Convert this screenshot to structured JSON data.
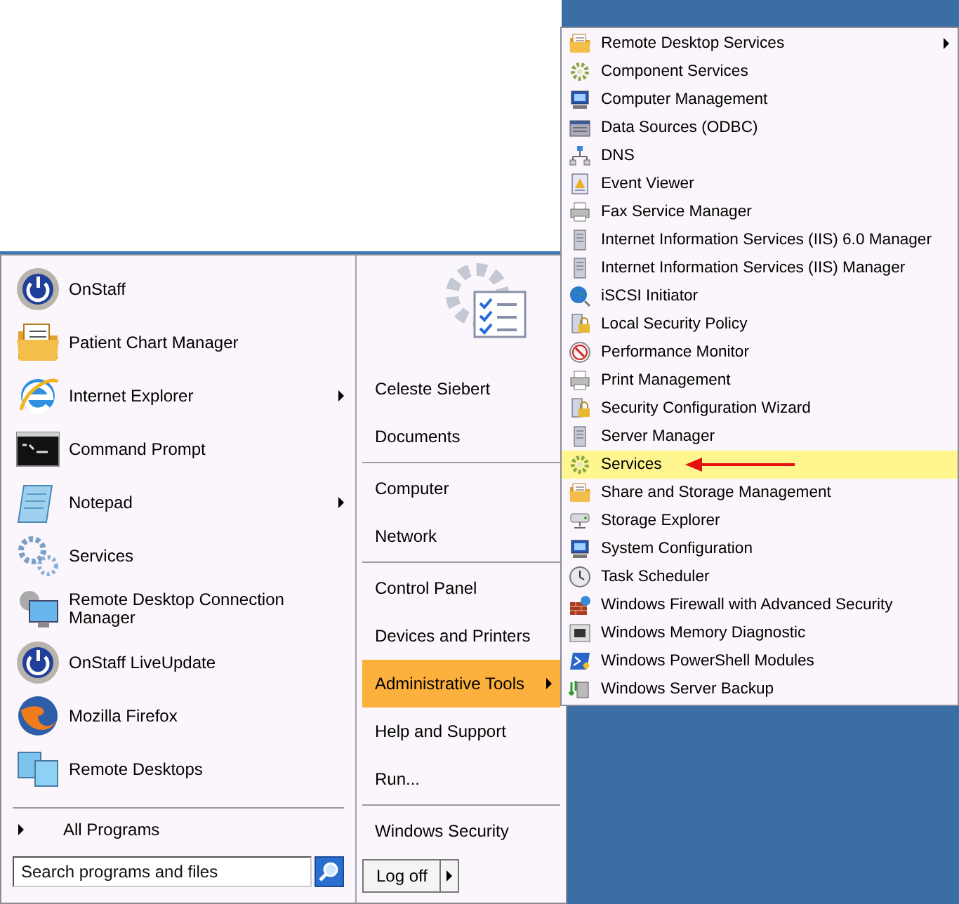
{
  "programs": [
    {
      "label": "OnStaff",
      "kind": "power",
      "has_submenu": false
    },
    {
      "label": "Patient Chart Manager",
      "kind": "folder",
      "has_submenu": false
    },
    {
      "label": "Internet Explorer",
      "kind": "browser",
      "has_submenu": true
    },
    {
      "label": "Command Prompt",
      "kind": "terminal",
      "has_submenu": false
    },
    {
      "label": "Notepad",
      "kind": "notepad",
      "has_submenu": true
    },
    {
      "label": "Services",
      "kind": "gears",
      "has_submenu": false
    },
    {
      "label": "Remote Desktop Connection Manager",
      "kind": "monitor",
      "has_submenu": false
    },
    {
      "label": "OnStaff LiveUpdate",
      "kind": "power",
      "has_submenu": false
    },
    {
      "label": "Mozilla Firefox",
      "kind": "fox",
      "has_submenu": false
    },
    {
      "label": "Remote Desktops",
      "kind": "monitors",
      "has_submenu": false
    }
  ],
  "all_programs": "All Programs",
  "search": {
    "placeholder": "Search programs and files"
  },
  "places": [
    {
      "label": "Celeste Siebert",
      "selected": false,
      "has_submenu": false,
      "divider_after": false
    },
    {
      "label": "Documents",
      "selected": false,
      "has_submenu": false,
      "divider_after": true
    },
    {
      "label": "Computer",
      "selected": false,
      "has_submenu": false,
      "divider_after": false
    },
    {
      "label": "Network",
      "selected": false,
      "has_submenu": false,
      "divider_after": true
    },
    {
      "label": "Control Panel",
      "selected": false,
      "has_submenu": false,
      "divider_after": false
    },
    {
      "label": "Devices and Printers",
      "selected": false,
      "has_submenu": false,
      "divider_after": false
    },
    {
      "label": "Administrative Tools",
      "selected": true,
      "has_submenu": true,
      "divider_after": false
    },
    {
      "label": "Help and Support",
      "selected": false,
      "has_submenu": false,
      "divider_after": false
    },
    {
      "label": "Run...",
      "selected": false,
      "has_submenu": false,
      "divider_after": true
    },
    {
      "label": "Windows Security",
      "selected": false,
      "has_submenu": false,
      "divider_after": false
    }
  ],
  "log_off": "Log off",
  "admin_tools": [
    {
      "label": "Remote Desktop Services",
      "kind": "folder",
      "selected": false,
      "has_submenu": true
    },
    {
      "label": "Component Services",
      "kind": "gear",
      "selected": false,
      "has_submenu": false
    },
    {
      "label": "Computer Management",
      "kind": "computer",
      "selected": false,
      "has_submenu": false
    },
    {
      "label": "Data Sources (ODBC)",
      "kind": "database",
      "selected": false,
      "has_submenu": false
    },
    {
      "label": "DNS",
      "kind": "network",
      "selected": false,
      "has_submenu": false
    },
    {
      "label": "Event Viewer",
      "kind": "log",
      "selected": false,
      "has_submenu": false
    },
    {
      "label": "Fax Service Manager",
      "kind": "printer",
      "selected": false,
      "has_submenu": false
    },
    {
      "label": "Internet Information Services (IIS) 6.0 Manager",
      "kind": "server",
      "selected": false,
      "has_submenu": false
    },
    {
      "label": "Internet Information Services (IIS) Manager",
      "kind": "server",
      "selected": false,
      "has_submenu": false
    },
    {
      "label": "iSCSI Initiator",
      "kind": "globe",
      "selected": false,
      "has_submenu": false
    },
    {
      "label": "Local Security Policy",
      "kind": "lock",
      "selected": false,
      "has_submenu": false
    },
    {
      "label": "Performance Monitor",
      "kind": "gauge",
      "selected": false,
      "has_submenu": false
    },
    {
      "label": "Print Management",
      "kind": "printer",
      "selected": false,
      "has_submenu": false
    },
    {
      "label": "Security Configuration Wizard",
      "kind": "lock",
      "selected": false,
      "has_submenu": false
    },
    {
      "label": "Server Manager",
      "kind": "server",
      "selected": false,
      "has_submenu": false
    },
    {
      "label": "Services",
      "kind": "gear",
      "selected": true,
      "has_submenu": false,
      "arrow_annotation": true
    },
    {
      "label": "Share and Storage Management",
      "kind": "folder",
      "selected": false,
      "has_submenu": false
    },
    {
      "label": "Storage Explorer",
      "kind": "disk",
      "selected": false,
      "has_submenu": false
    },
    {
      "label": "System Configuration",
      "kind": "computer",
      "selected": false,
      "has_submenu": false
    },
    {
      "label": "Task Scheduler",
      "kind": "clock",
      "selected": false,
      "has_submenu": false
    },
    {
      "label": "Windows Firewall with Advanced Security",
      "kind": "wall",
      "selected": false,
      "has_submenu": false
    },
    {
      "label": "Windows Memory Diagnostic",
      "kind": "chip",
      "selected": false,
      "has_submenu": false
    },
    {
      "label": "Windows PowerShell Modules",
      "kind": "shell",
      "selected": false,
      "has_submenu": false
    },
    {
      "label": "Windows Server Backup",
      "kind": "backup",
      "selected": false,
      "has_submenu": false
    }
  ]
}
